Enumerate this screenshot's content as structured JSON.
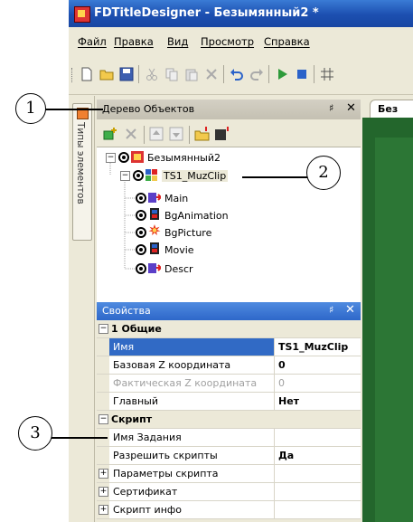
{
  "window": {
    "title": "FDTitleDesigner - Безымянный2 *",
    "menu": [
      "Файл",
      "Правка",
      "Вид",
      "Просмотр",
      "Справка"
    ]
  },
  "side_tab": {
    "label": "Типы элементов"
  },
  "object_tree": {
    "title": "Дерево Объектов",
    "pin": "♯",
    "close": "✕",
    "root": "Безымянный2",
    "clip": "TS1_MuzClip",
    "children": [
      "Main",
      "BgAnimation",
      "BgPicture",
      "Movie",
      "Descr"
    ]
  },
  "document_tab": {
    "label": "Без"
  },
  "properties": {
    "title": "Свойства",
    "pin": "♯",
    "close": "✕",
    "rows": [
      {
        "type": "category",
        "key": "1 Общие",
        "expander": "⊟"
      },
      {
        "type": "prop",
        "key": "Имя",
        "value": "TS1_MuzClip",
        "selected": true
      },
      {
        "type": "prop",
        "key": "Базовая Z координата",
        "value": "0"
      },
      {
        "type": "prop",
        "key": "Фактическая Z координата",
        "value": "0",
        "disabled": true
      },
      {
        "type": "prop",
        "key": "Главный",
        "value": "Нет"
      },
      {
        "type": "category",
        "key": "Скрипт",
        "expander": "⊟"
      },
      {
        "type": "prop",
        "key": "Имя Задания",
        "value": ""
      },
      {
        "type": "prop",
        "key": "Разрешить скрипты",
        "value": "Да"
      },
      {
        "type": "group",
        "key": "Параметры скрипта",
        "value": "",
        "expander": "+"
      },
      {
        "type": "group",
        "key": "Сертификат",
        "value": "",
        "expander": "+"
      },
      {
        "type": "group",
        "key": "Скрипт инфо",
        "value": "",
        "expander": "+"
      }
    ]
  },
  "callouts": [
    "1",
    "2",
    "3"
  ],
  "colors": {
    "titlebar": "#1c4fb0",
    "selection": "#316ac5",
    "canvas": "#23662c",
    "props_header": "#2e67c9"
  }
}
